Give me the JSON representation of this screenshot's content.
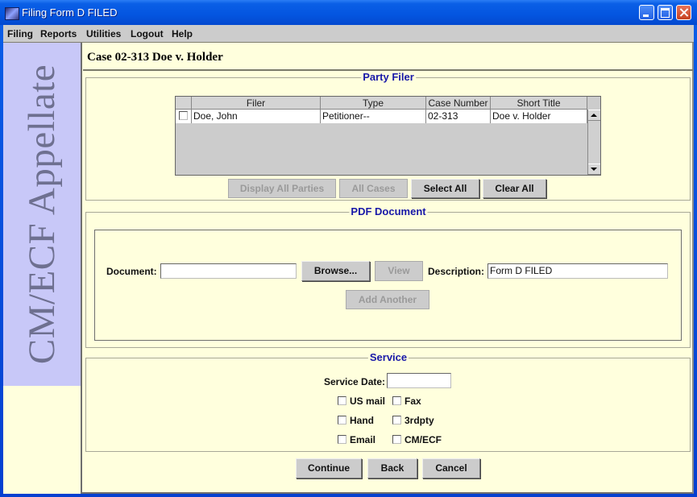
{
  "window": {
    "title": "Filing Form D FILED"
  },
  "menu": {
    "items": [
      "Filing",
      "Reports",
      "Utilities",
      "Logout",
      "Help"
    ]
  },
  "sidebar": {
    "logo_text": "CM/ECF Appellate"
  },
  "case": {
    "heading": "Case 02-313 Doe v. Holder"
  },
  "party_filer": {
    "legend": "Party Filer",
    "columns": [
      "Filer",
      "Type",
      "Case Number",
      "Short Title"
    ],
    "rows": [
      {
        "checked": false,
        "filer": "Doe, John",
        "type": "Petitioner--",
        "case_number": "02-313",
        "short_title": "Doe v. Holder"
      }
    ],
    "buttons": {
      "display_all_parties": "Display All Parties",
      "all_cases": "All Cases",
      "select_all": "Select All",
      "clear_all": "Clear All"
    }
  },
  "pdf_document": {
    "legend": "PDF Document",
    "document_label": "Document:",
    "document_value": "",
    "browse_label": "Browse...",
    "view_label": "View",
    "description_label": "Description:",
    "description_value": "Form D FILED",
    "add_another_label": "Add Another"
  },
  "service": {
    "legend": "Service",
    "date_label": "Service Date:",
    "date_value": "",
    "options": [
      {
        "label": "US mail",
        "checked": false
      },
      {
        "label": "Fax",
        "checked": false
      },
      {
        "label": "Hand",
        "checked": false
      },
      {
        "label": "3rdpty",
        "checked": false
      },
      {
        "label": "Email",
        "checked": false
      },
      {
        "label": "CM/ECF",
        "checked": false
      }
    ]
  },
  "actions": {
    "continue": "Continue",
    "back": "Back",
    "cancel": "Cancel"
  }
}
